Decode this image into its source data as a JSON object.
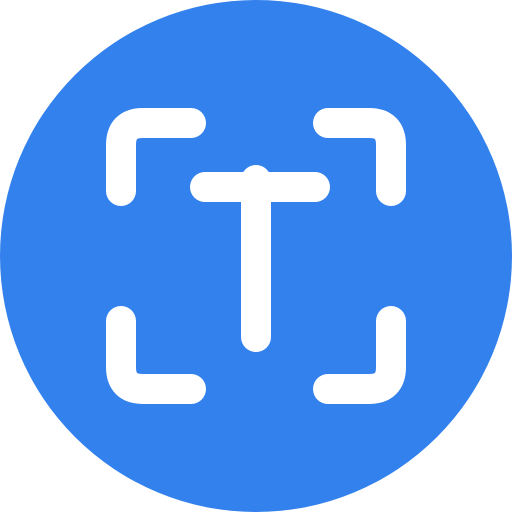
{
  "icon": {
    "name": "text-recognition-icon",
    "colors": {
      "background": "#3381ED",
      "foreground": "#FFFFFF"
    }
  }
}
